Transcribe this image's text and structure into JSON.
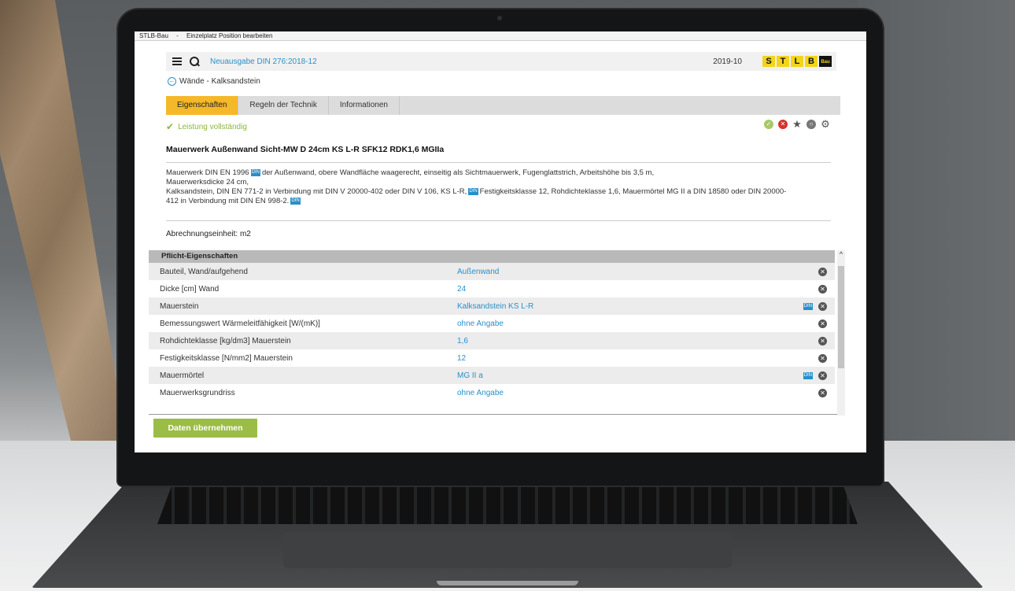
{
  "window": {
    "app": "STLB-Bau",
    "separator": "-",
    "title": "Einzelplatz Position bearbeiten"
  },
  "header": {
    "edition": "Neuausgabe DIN 276:2018-12",
    "version": "2019-10",
    "logo_letters": [
      "S",
      "T",
      "L",
      "B",
      "Bau"
    ]
  },
  "breadcrumb": "Wände - Kalksandstein",
  "tabs": [
    {
      "label": "Eigenschaften",
      "active": true
    },
    {
      "label": "Regeln der Technik",
      "active": false
    },
    {
      "label": "Informationen",
      "active": false
    }
  ],
  "status": {
    "text": "Leistung vollständig",
    "color": "#8bb73e"
  },
  "actions": [
    "check-icon",
    "delete-icon",
    "star-icon",
    "circle-icon",
    "gear-icon"
  ],
  "position": {
    "title": "Mauerwerk Außenwand Sicht-MW D 24cm KS L-R SFK12 RDK1,6 MGIIa",
    "description_lines": [
      {
        "text": "Mauerwerk DIN EN 1996",
        "din": true,
        "rest": "der Außenwand, obere Wandfläche waagerecht, einseitig als Sichtmauerwerk, Fugenglattstrich, Arbeitshöhe bis 3,5 m,"
      },
      {
        "text": "Mauerwerksdicke 24 cm,"
      },
      {
        "text": "Kalksandstein, DIN EN 771-2 in Verbindung mit DIN V 20000-402 oder DIN V 106, KS L-R,",
        "din": true,
        "rest": "Festigkeitsklasse 12, Rohdichteklasse 1,6, Mauermörtel MG II a DIN 18580 oder DIN 20000-"
      },
      {
        "text": "412 in Verbindung mit DIN EN 998-2.",
        "din": true
      }
    ],
    "unit": "Abrechnungseinheit: m2"
  },
  "din_badge": "DIN",
  "properties": {
    "header": "Pflicht-Eigenschaften",
    "rows": [
      {
        "label": "Bauteil, Wand/aufgehend",
        "value": "Außenwand",
        "din": false
      },
      {
        "label": "Dicke [cm] Wand",
        "value": "24",
        "din": false
      },
      {
        "label": "Mauerstein",
        "value": "Kalksandstein KS L-R",
        "din": true
      },
      {
        "label": "Bemessungswert Wärmeleitfähigkeit [W/(mK)]",
        "value": "ohne Angabe",
        "din": false
      },
      {
        "label": "Rohdichteklasse [kg/dm3] Mauerstein",
        "value": "1,6",
        "din": false
      },
      {
        "label": "Festigkeitsklasse [N/mm2] Mauerstein",
        "value": "12",
        "din": false
      },
      {
        "label": "Mauermörtel",
        "value": "MG II a",
        "din": true
      },
      {
        "label": "Mauerwerksgrundriss",
        "value": "ohne Angabe",
        "din": false
      }
    ]
  },
  "apply_button": "Daten übernehmen",
  "colors": {
    "accent": "#2a8fc9",
    "tab_active": "#f5b82a",
    "button": "#9bbd47",
    "delete": "#d8312e"
  }
}
